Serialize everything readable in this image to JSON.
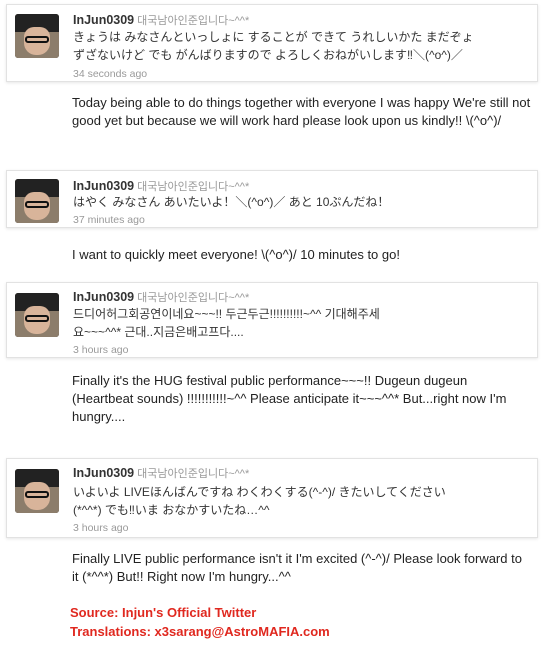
{
  "tweets": [
    {
      "handle": "InJun0309",
      "fullname": "대국남아인준입니다~^^*",
      "text_line1": "きょうは みなさんといっしょに することが できて うれしいかた まだぞょ",
      "text_line2": "ずざないけど でも がんばりますので よろしくおねがいします‼＼(^o^)／",
      "time": "34 seconds ago",
      "translation": "Today being able to do things together with everyone I was happy We're still not good yet but because we will work hard please look upon us kindly!! \\(^o^)/"
    },
    {
      "handle": "InJun0309",
      "fullname": "대국남아인준입니다~^^*",
      "text_line1": "はやく みなさん あいたいよ！＼(^o^)／ あと 10ぷんだね！",
      "text_line2": "",
      "time": "37 minutes ago",
      "translation": "I want to quickly meet everyone! \\(^o^)/ 10 minutes to go!"
    },
    {
      "handle": "InJun0309",
      "fullname": "대국남아인준입니다~^^*",
      "text_line1": "드디어허그회공연이네요~~~!! 두근두근!!!!!!!!!!~^^ 기대해주세",
      "text_line2": "요~~~^^* 근대..지금은배고프다....",
      "time": "3 hours ago",
      "translation": "Finally it's the HUG festival public performance~~~!! Dugeun dugeun (Heartbeat sounds) !!!!!!!!!!!~^^ Please anticipate it~~~^^* But...right now I'm hungry...."
    },
    {
      "handle": "InJun0309",
      "fullname": "대국남아인준입니다~^^*",
      "text_line1": "いよいよ LIVEほんばんですね わくわくする(^-^)/ きたいしてください",
      "text_line2": "(*^^*) でも‼いま おなかすいたね…^^",
      "time": "3 hours ago",
      "translation": "Finally LIVE public performance isn't it I'm excited (^-^)/ Please look forward to it (*^^*) But!! Right now I'm hungry...^^"
    }
  ],
  "credits": {
    "source": "Source: Injun's Official Twitter",
    "translations": "Translations: x3sarang@AstroMAFIA.com"
  }
}
